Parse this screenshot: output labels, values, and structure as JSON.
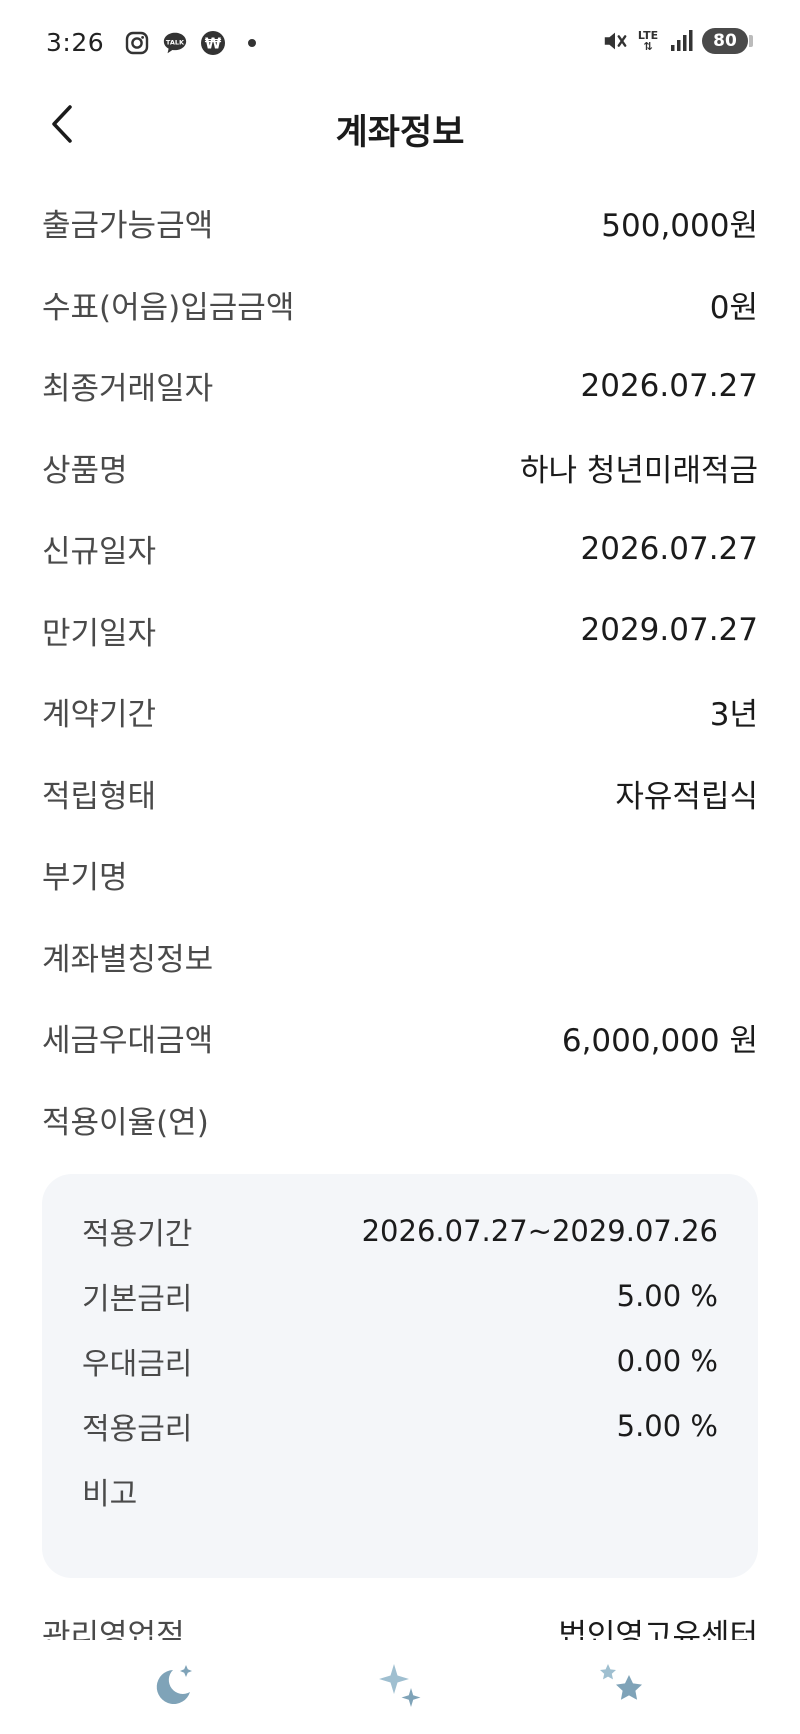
{
  "status_bar": {
    "time": "3:26",
    "icons_left": [
      "instagram-icon",
      "kakaotalk-icon",
      "won-icon"
    ],
    "talk_text": "TALK",
    "won_text": "₩",
    "network": "LTE",
    "battery": "80"
  },
  "header": {
    "title": "계좌정보"
  },
  "account_info": [
    {
      "label": "출금가능금액",
      "value": "500,000원"
    },
    {
      "label": "수표(어음)입금금액",
      "value": "0원"
    },
    {
      "label": "최종거래일자",
      "value": "2026.07.27"
    },
    {
      "label": "상품명",
      "value": "하나 청년미래적금"
    },
    {
      "label": "신규일자",
      "value": "2026.07.27"
    },
    {
      "label": "만기일자",
      "value": "2029.07.27"
    },
    {
      "label": "계약기간",
      "value": "3년"
    },
    {
      "label": "적립형태",
      "value": "자유적립식"
    },
    {
      "label": "부기명",
      "value": ""
    },
    {
      "label": "계좌별칭정보",
      "value": ""
    },
    {
      "label": "세금우대금액",
      "value": "6,000,000 원"
    },
    {
      "label": "적용이율(연)",
      "value": ""
    }
  ],
  "rate_details": [
    {
      "label": "적용기간",
      "value": "2026.07.27~2029.07.26"
    },
    {
      "label": "기본금리",
      "value": "5.00 %"
    },
    {
      "label": "우대금리",
      "value": "0.00 %"
    },
    {
      "label": "적용금리",
      "value": "5.00 %"
    },
    {
      "label": "비고",
      "value": ""
    }
  ],
  "partial_row": {
    "label": "관리영업점",
    "value": "법인영고유센터"
  },
  "bottom_nav": {
    "items": [
      "moon-star-icon",
      "sparkle-icon",
      "stars-icon"
    ],
    "color": "#7fa3b8"
  }
}
